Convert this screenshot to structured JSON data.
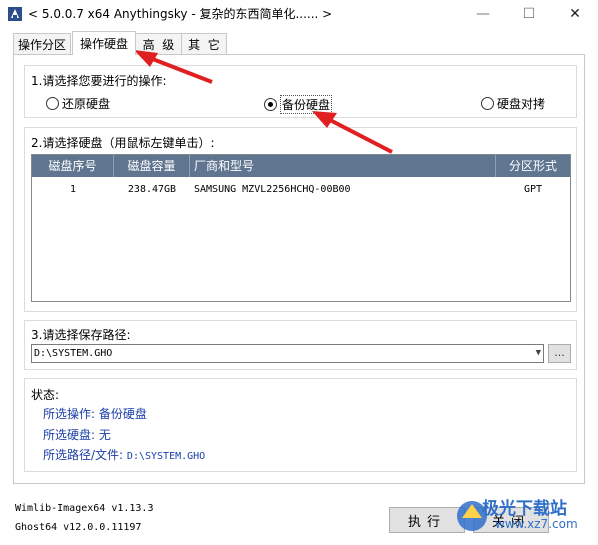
{
  "window": {
    "title": "< 5.0.0.7 x64 Anythingsky - 复杂的东西简单化...... >",
    "icon": "app-icon",
    "minimize_glyph": "—",
    "maximize_glyph": "☐",
    "close_glyph": "✕"
  },
  "tabs": [
    {
      "label": "操作分区",
      "active": false
    },
    {
      "label": "操作硬盘",
      "active": true
    },
    {
      "label": "高  级",
      "active": false
    },
    {
      "label": "其  它",
      "active": false
    }
  ],
  "operation": {
    "title": "1.请选择您要进行的操作:",
    "options": [
      {
        "label": "还原硬盘",
        "checked": false
      },
      {
        "label": "备份硬盘",
        "checked": true
      },
      {
        "label": "硬盘对拷",
        "checked": false
      }
    ]
  },
  "disk": {
    "title": "2.请选择硬盘（用鼠标左键单击）:",
    "columns": [
      "磁盘序号",
      "磁盘容量",
      "厂商和型号",
      "分区形式"
    ],
    "rows": [
      {
        "index": "1",
        "capacity": "238.47GB",
        "model": "SAMSUNG MZVL2256HCHQ-00B00",
        "scheme": "GPT"
      }
    ]
  },
  "save": {
    "title": "3.请选择保存路径:",
    "path": "D:\\SYSTEM.GHO",
    "browse_label": "..."
  },
  "status": {
    "title": "状态:",
    "operation": "所选操作: 备份硬盘",
    "disk": "所选硬盘: 无",
    "path_label": "所选路径/文件:",
    "path_value": "D:\\SYSTEM.GHO"
  },
  "versions": {
    "wimlib": "Wimlib-Imagex64 v1.13.3",
    "ghost": "Ghost64 v12.0.0.11197"
  },
  "buttons": {
    "execute": "执行",
    "close": "关闭"
  },
  "watermark": {
    "text": "极光下载站",
    "url": "www.xz7.com"
  },
  "colors": {
    "header_bg": "#5f7590",
    "status_text": "#1a3fa6",
    "annotation_arrow": "#e02020"
  }
}
